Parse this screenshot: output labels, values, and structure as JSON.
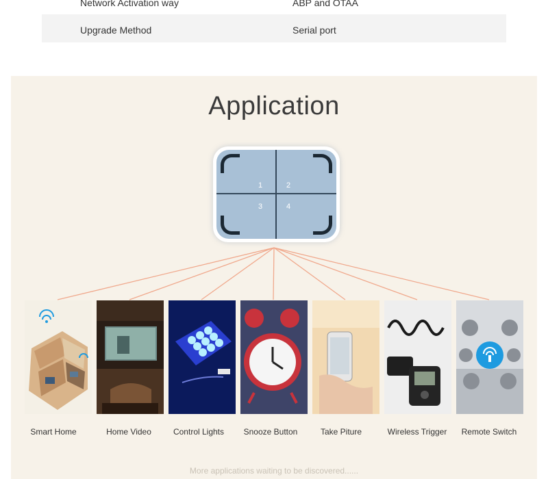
{
  "specs": [
    {
      "label": "Network Activation way",
      "value": "ABP and OTAA"
    },
    {
      "label": "Upgrade Method",
      "value": "Serial port"
    }
  ],
  "application": {
    "title": "Application",
    "device": {
      "buttons": [
        "1",
        "2",
        "3",
        "4"
      ]
    },
    "items": [
      {
        "label": "Smart Home",
        "image": "house-floorplan-image"
      },
      {
        "label": "Home Video",
        "image": "home-theater-image"
      },
      {
        "label": "Control Lights",
        "image": "led-lights-image"
      },
      {
        "label": "Snooze Button",
        "image": "alarm-clock-image"
      },
      {
        "label": "Take Piture",
        "image": "phone-in-hand-image"
      },
      {
        "label": "Wireless Trigger",
        "image": "camera-trigger-image"
      },
      {
        "label": "Remote Switch",
        "image": "remote-switch-image"
      }
    ],
    "footer": "More applications waiting to be discovered......"
  },
  "colors": {
    "section_bg": "#f7f2e9",
    "connector": "#f0a88c",
    "device_face": "#a8c0d6",
    "wifi_accent": "#1e9be0"
  }
}
